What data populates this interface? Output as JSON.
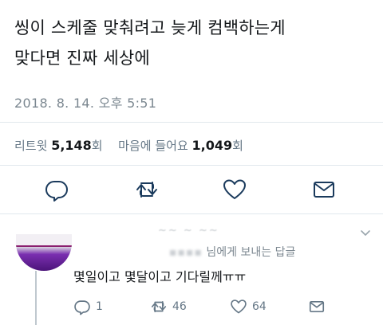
{
  "tweet": {
    "text_line1": "씽이 스케줄 맞춰려고 늦게 컴백하는게",
    "text_line2": "맞다면 진짜 세상에",
    "timestamp": "2018. 8. 14. 오후 5:51"
  },
  "stats": {
    "retweets_label": "리트윗",
    "retweets_count": "5,148",
    "retweets_unit": "회",
    "likes_label": "마음에 들어요",
    "likes_count": "1,049",
    "likes_unit": "회"
  },
  "actions": {
    "icons": [
      "reply-icon",
      "retweet-icon",
      "like-icon",
      "message-icon"
    ]
  },
  "reply": {
    "header_obscured": "~~ ~ ~~",
    "replying_label": "님에게 보내는 답글",
    "text": "몇일이고 몇달이고 기다릴께ㅠㅠ",
    "reply_count": "1",
    "retweet_count": "46",
    "like_count": "64"
  },
  "colors": {
    "text": "#14171a",
    "muted": "#657786",
    "icon": "#1a3a5c",
    "divider": "#e1e8ed"
  }
}
